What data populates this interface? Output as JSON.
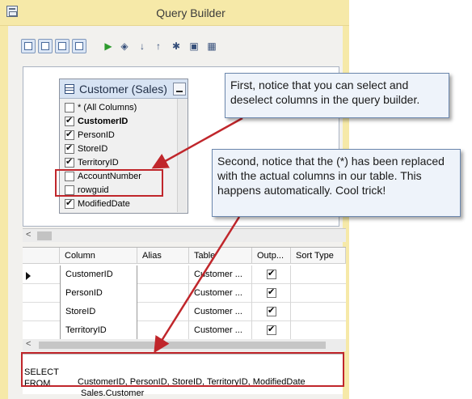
{
  "window": {
    "title": "Query Builder"
  },
  "toolbar": {
    "buttons": [
      "diagram-pane-toggle",
      "criteria-pane-toggle",
      "sql-pane-toggle",
      "results-pane-toggle",
      "execute",
      "verify-sql",
      "sort-ascending",
      "sort-descending",
      "remove-filter",
      "group-by",
      "add-table"
    ]
  },
  "diagram": {
    "table_title": "Customer (Sales)",
    "columns": [
      {
        "label": "* (All Columns)",
        "checked": false,
        "bold": false
      },
      {
        "label": "CustomerID",
        "checked": true,
        "bold": true
      },
      {
        "label": "PersonID",
        "checked": true,
        "bold": false
      },
      {
        "label": "StoreID",
        "checked": true,
        "bold": false
      },
      {
        "label": "TerritoryID",
        "checked": true,
        "bold": false
      },
      {
        "label": "AccountNumber",
        "checked": false,
        "bold": false
      },
      {
        "label": "rowguid",
        "checked": false,
        "bold": false
      },
      {
        "label": "ModifiedDate",
        "checked": true,
        "bold": false
      }
    ]
  },
  "grid": {
    "headers": [
      "Column",
      "Alias",
      "Table",
      "Outp...",
      "Sort Type"
    ],
    "rows": [
      {
        "column": "CustomerID",
        "alias": "",
        "table": "Customer ...",
        "output": true
      },
      {
        "column": "PersonID",
        "alias": "",
        "table": "Customer ...",
        "output": true
      },
      {
        "column": "StoreID",
        "alias": "",
        "table": "Customer ...",
        "output": true
      },
      {
        "column": "TerritoryID",
        "alias": "",
        "table": "Customer ...",
        "output": true
      }
    ]
  },
  "sql": {
    "line1_keyword": "SELECT",
    "line1_text": "CustomerID, PersonID, StoreID, TerritoryID, ModifiedDate",
    "line2_keyword": "FROM",
    "line2_text": "Sales.Customer"
  },
  "callouts": {
    "first": "First, notice that you can select and deselect columns in the query builder.",
    "second": "Second, notice that the (*) has been replaced with the actual columns in our table. This happens automatically. Cool trick!"
  },
  "colors": {
    "highlight": "#c0262b",
    "titlebar": "#f6e9a8",
    "callout_bg": "#eef3fa"
  }
}
